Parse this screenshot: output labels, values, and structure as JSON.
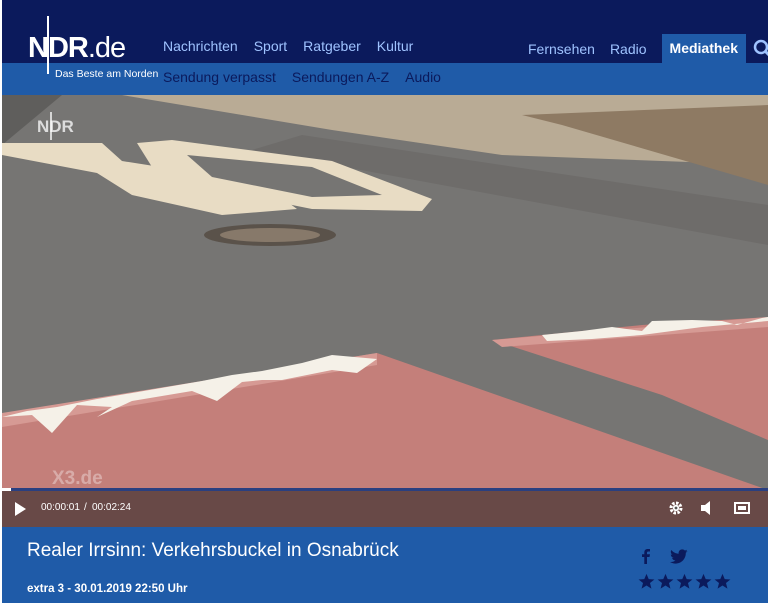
{
  "header": {
    "logo_text": "NDR",
    "logo_domain": ".de",
    "tagline": "Das Beste am Norden",
    "nav_main": [
      "Nachrichten",
      "Sport",
      "Ratgeber",
      "Kultur"
    ],
    "nav_right": [
      "Fernsehen",
      "Radio",
      "Mediathek"
    ],
    "nav_active": "Mediathek",
    "nav_sub": [
      "Sendung verpasst",
      "Sendungen A-Z",
      "Audio"
    ],
    "search_icon": "search-icon"
  },
  "video": {
    "channel_bug": "NDR",
    "watermark": "X3.de",
    "current_time": "00:00:01",
    "separator": "/",
    "duration": "00:02:24",
    "progress_fraction": 0.007,
    "icons": [
      "play-icon",
      "settings-gear-icon",
      "volume-icon",
      "fullscreen-icon"
    ]
  },
  "info": {
    "title": "Realer Irrsinn: Verkehrsbuckel in Osnabrück",
    "meta": "extra 3 - 30.01.2019 22:50 Uhr",
    "share_icons": [
      "facebook-icon",
      "twitter-icon"
    ],
    "rating_stars": 5
  },
  "colors": {
    "header_dark": "#0b1a5c",
    "header_blue": "#1f5ba8",
    "nav_link": "#9fc3ff",
    "star": "#0b1a5c"
  }
}
